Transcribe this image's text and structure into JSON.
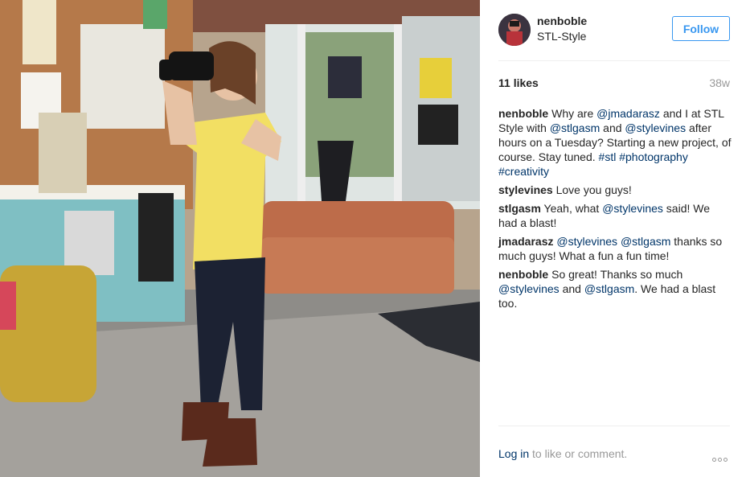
{
  "post": {
    "username": "nenboble",
    "location": "STL-Style",
    "follow_label": "Follow",
    "likes": "11 likes",
    "age": "38w"
  },
  "caption": {
    "author": "nenboble",
    "parts": [
      {
        "text": " Why are ",
        "tag": false
      },
      {
        "text": "@jmadarasz",
        "tag": true
      },
      {
        "text": " and I at STL Style with ",
        "tag": false
      },
      {
        "text": "@stlgasm",
        "tag": true
      },
      {
        "text": " and ",
        "tag": false
      },
      {
        "text": "@stylevines",
        "tag": true
      },
      {
        "text": " after hours on a Tuesday? Starting a new project, of course. Stay tuned. ",
        "tag": false
      },
      {
        "text": "#stl",
        "tag": true
      },
      {
        "text": " ",
        "tag": false
      },
      {
        "text": "#photography",
        "tag": true
      },
      {
        "text": " ",
        "tag": false
      },
      {
        "text": "#creativity",
        "tag": true
      }
    ]
  },
  "comments": [
    {
      "author": "stylevines",
      "parts": [
        {
          "text": " Love you guys!",
          "tag": false
        }
      ]
    },
    {
      "author": "stlgasm",
      "parts": [
        {
          "text": " Yeah, what ",
          "tag": false
        },
        {
          "text": "@stylevines",
          "tag": true
        },
        {
          "text": " said! We had a blast!",
          "tag": false
        }
      ]
    },
    {
      "author": "jmadarasz",
      "parts": [
        {
          "text": " ",
          "tag": false
        },
        {
          "text": "@stylevines",
          "tag": true
        },
        {
          "text": " ",
          "tag": false
        },
        {
          "text": "@stlgasm",
          "tag": true
        },
        {
          "text": " thanks so much guys! What a fun a fun time!",
          "tag": false
        }
      ]
    },
    {
      "author": "nenboble",
      "parts": [
        {
          "text": " So great! Thanks so much ",
          "tag": false
        },
        {
          "text": "@stylevines",
          "tag": true
        },
        {
          "text": " and ",
          "tag": false
        },
        {
          "text": "@stlgasm",
          "tag": true
        },
        {
          "text": ". We had a blast too.",
          "tag": false
        }
      ]
    }
  ],
  "footer": {
    "login_link": "Log in",
    "login_rest": " to like or comment."
  },
  "icons": {
    "more": "more-options-icon"
  },
  "colors": {
    "accent": "#3897f0",
    "link": "#003569",
    "muted": "#999999"
  }
}
